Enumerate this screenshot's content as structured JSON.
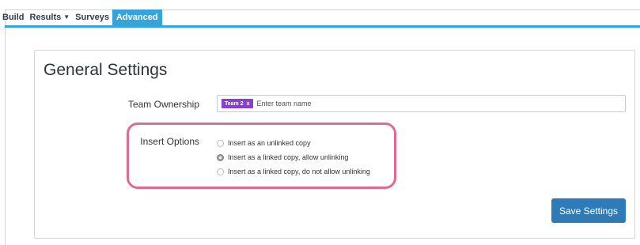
{
  "nav": {
    "items": [
      {
        "label": "Build",
        "active": false,
        "dropdown": false
      },
      {
        "label": "Results",
        "active": false,
        "dropdown": true
      },
      {
        "label": "Surveys",
        "active": false,
        "dropdown": false
      },
      {
        "label": "Advanced",
        "active": true,
        "dropdown": false
      }
    ],
    "accent_color": "#35a4dd"
  },
  "settings": {
    "title": "General Settings",
    "team_ownership": {
      "label": "Team Ownership",
      "chip_label": "Team 2",
      "chip_remove": "x",
      "placeholder": "Enter team name",
      "chip_color": "#8a3fd1"
    },
    "insert_options": {
      "label": "Insert Options",
      "options": [
        {
          "label": "Insert as an unlinked copy",
          "selected": false
        },
        {
          "label": "Insert as a linked copy, allow unlinking",
          "selected": true
        },
        {
          "label": "Insert as a linked copy, do not allow unlinking",
          "selected": false
        }
      ],
      "highlight_color": "#e06a93"
    },
    "save_label": "Save Settings",
    "save_color": "#2d7bb8"
  }
}
